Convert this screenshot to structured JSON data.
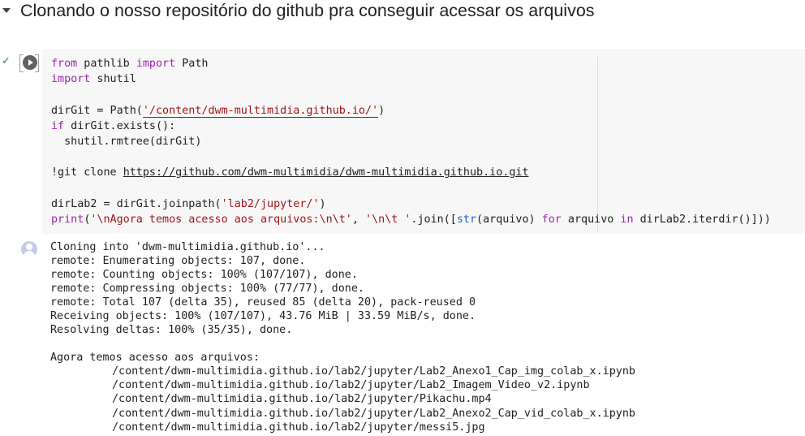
{
  "section": {
    "title": "Clonando o nosso repositório do github pra conseguir acessar os arquivos"
  },
  "cell": {
    "status": "✓",
    "code": {
      "l1_kw1": "from",
      "l1_mod": " pathlib ",
      "l1_kw2": "import",
      "l1_name": " Path",
      "l2_kw": "import",
      "l2_mod": " shutil",
      "l4_a": "dirGit = Path(",
      "l4_str": "'/content/dwm-multimidia.github.io/'",
      "l4_b": ")",
      "l5_kw": "if",
      "l5_rest": " dirGit.exists():",
      "l6": "  shutil.rmtree(dirGit)",
      "l8_cmd": "!git clone ",
      "l8_url": "https://github.com/dwm-multimidia/dwm-multimidia.github.io.git",
      "l10_a": "dirLab2 = dirGit.joinpath(",
      "l10_str": "'lab2/jupyter/'",
      "l10_b": ")",
      "l11_fn": "print",
      "l11_a": "(",
      "l11_str1": "'\\nAgora temos acesso aos arquivos:\\n\\t'",
      "l11_b": ", ",
      "l11_str2": "'\\n\\t '",
      "l11_c": ".join([",
      "l11_fn2": "str",
      "l11_d": "(arquivo) ",
      "l11_kw1": "for",
      "l11_e": " arquivo ",
      "l11_kw2": "in",
      "l11_f": " dirLab2.iterdir()]))"
    }
  },
  "output": {
    "log": [
      "Cloning into 'dwm-multimidia.github.io'...",
      "remote: Enumerating objects: 107, done.",
      "remote: Counting objects: 100% (107/107), done.",
      "remote: Compressing objects: 100% (77/77), done.",
      "remote: Total 107 (delta 35), reused 85 (delta 20), pack-reused 0",
      "Receiving objects: 100% (107/107), 43.76 MiB | 33.59 MiB/s, done.",
      "Resolving deltas: 100% (35/35), done.",
      "",
      "Agora temos acesso aos arquivos:"
    ],
    "files": [
      "/content/dwm-multimidia.github.io/lab2/jupyter/Lab2_Anexo1_Cap_img_colab_x.ipynb",
      "/content/dwm-multimidia.github.io/lab2/jupyter/Lab2_Imagem_Video_v2.ipynb",
      "/content/dwm-multimidia.github.io/lab2/jupyter/Pikachu.mp4",
      "/content/dwm-multimidia.github.io/lab2/jupyter/Lab2_Anexo2_Cap_vid_colab_x.ipynb",
      "/content/dwm-multimidia.github.io/lab2/jupyter/messi5.jpg"
    ]
  }
}
